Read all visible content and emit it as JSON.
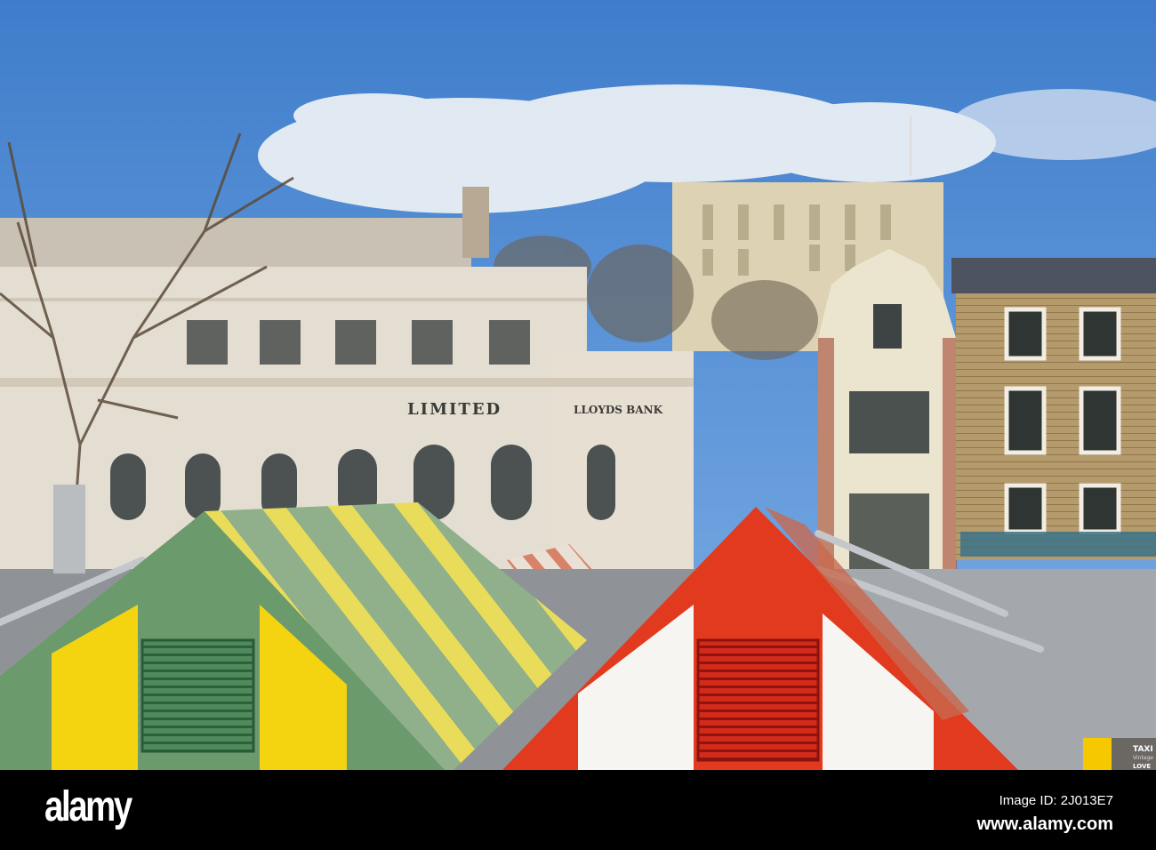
{
  "scene": {
    "bank_sign_left": "LIMITED",
    "bank_sign_right": "LLOYDS BANK",
    "taxi_sign": {
      "line1": "TAXI",
      "line2": "Vintage",
      "line3": "LOVE"
    }
  },
  "watermark": {
    "logo": "alamy",
    "image_id": "Image ID: 2J013E7",
    "site": "www.alamy.com"
  },
  "colors": {
    "sky": "#4a86cf",
    "stone": "#e3ddd0",
    "red_stall": "#e23a1e",
    "yellow_stall": "#f3d411",
    "green_stall": "#6a9a6a"
  }
}
